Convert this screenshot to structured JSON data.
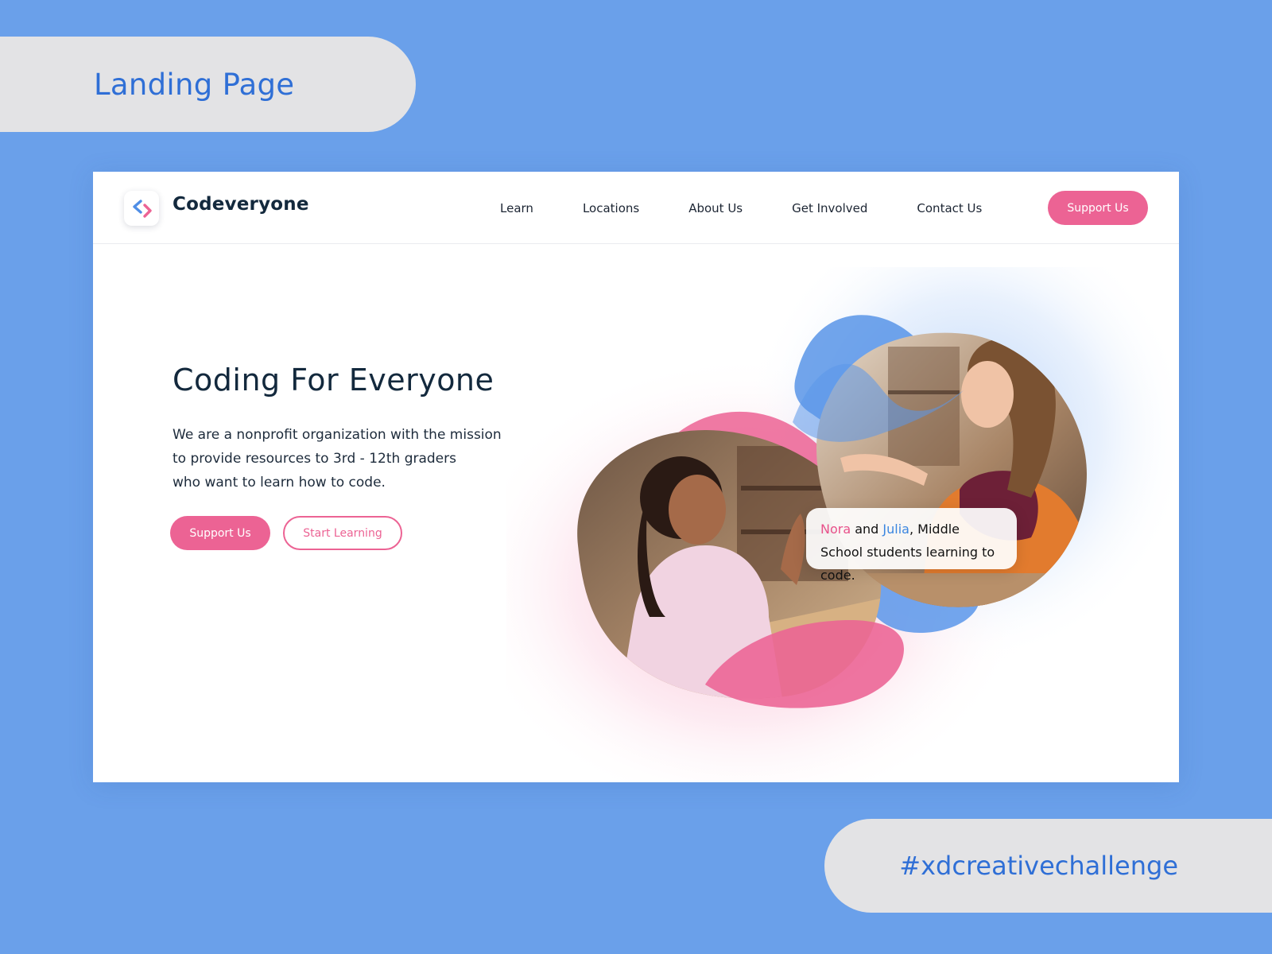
{
  "labels": {
    "top": "Landing Page",
    "bottom": "#xdcreativechallenge"
  },
  "nav": {
    "brand": "Codeveryone",
    "links": [
      "Learn",
      "Locations",
      "About Us",
      "Get Involved",
      "Contact Us"
    ],
    "cta": "Support Us"
  },
  "hero": {
    "title": "Coding For Everyone",
    "description_lines": [
      "We are a nonprofit organization with the mission",
      "to provide resources to 3rd - 12th graders",
      "who want to learn how to code."
    ],
    "primary_button": "Support Us",
    "secondary_button": "Start Learning"
  },
  "caption": {
    "name1": "Nora",
    "and": " and ",
    "name2": "Julia",
    "rest": ", Middle School students learning to code."
  },
  "colors": {
    "accent_pink": "#ec6394",
    "accent_blue": "#3b86e0",
    "background": "#6aa0ea",
    "heading": "#13293d"
  },
  "icons": {
    "logo": "code-brackets-icon"
  }
}
